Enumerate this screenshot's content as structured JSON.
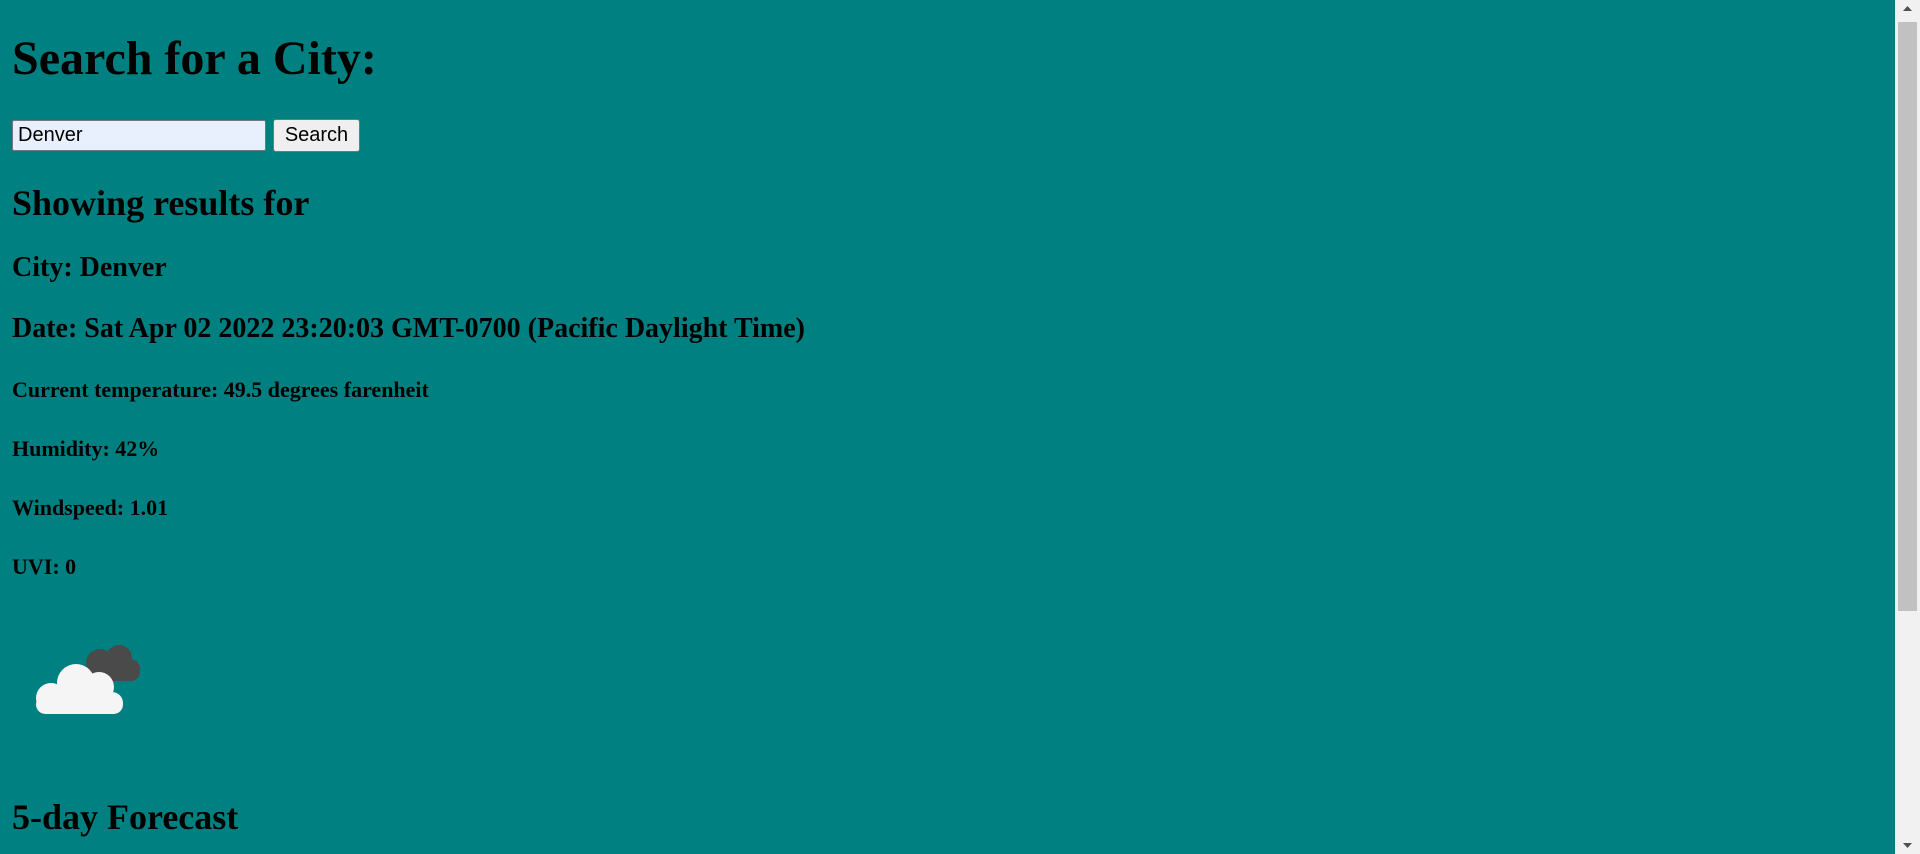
{
  "search": {
    "heading": "Search for a City:",
    "input_value": "Denver",
    "button_label": "Search"
  },
  "results": {
    "heading": "Showing results for",
    "city": "City: Denver",
    "date": "Date: Sat Apr 02 2022 23:20:03 GMT-0700 (Pacific Daylight Time)",
    "temperature": "Current temperature: 49.5 degrees farenheit",
    "humidity": "Humidity: 42%",
    "windspeed": "Windspeed: 1.01",
    "uvi": "UVI: 0",
    "icon": "partly-cloudy-night-icon"
  },
  "forecast": {
    "heading": "5-day Forecast"
  },
  "colors": {
    "background": "#008080",
    "input_background": "#e8f0fe",
    "cloud_light": "#f5f5f5",
    "cloud_dark": "#4a4a4a"
  }
}
